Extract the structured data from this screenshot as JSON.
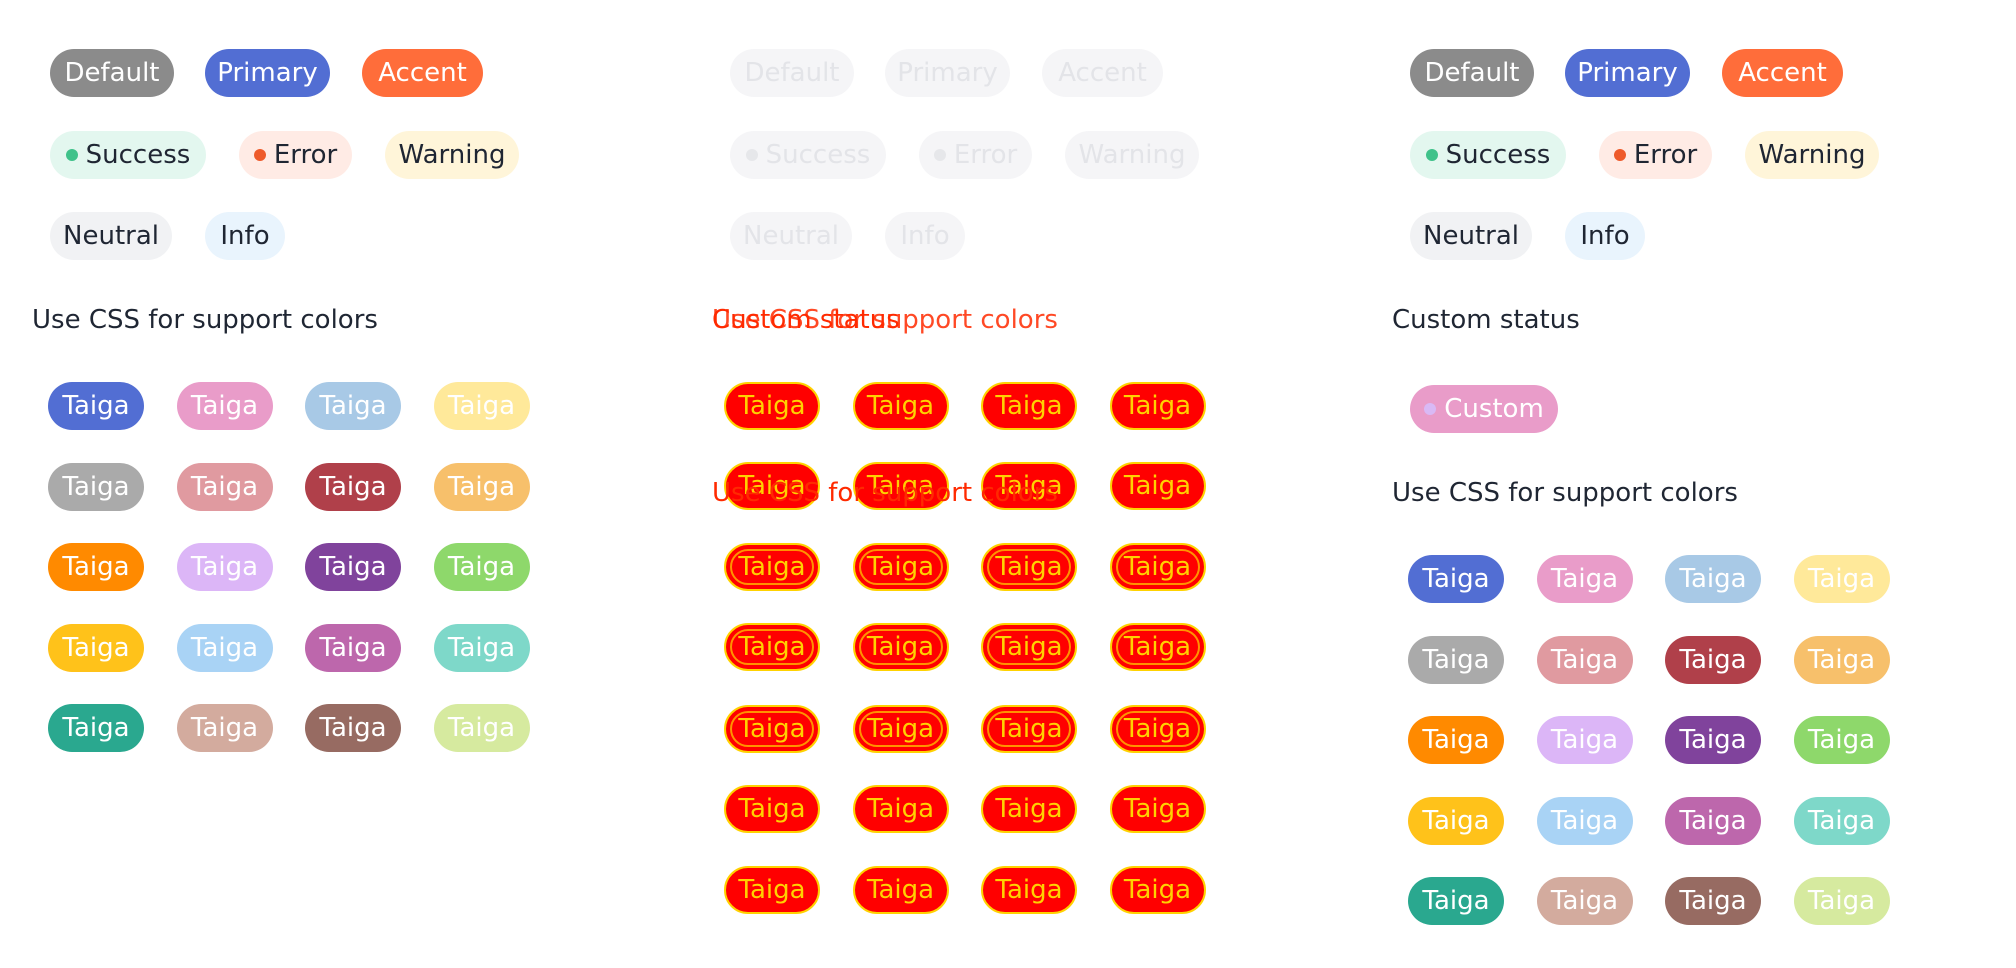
{
  "status_chips": {
    "default": "Default",
    "primary": "Primary",
    "accent": "Accent",
    "success": "Success",
    "error": "Error",
    "warning": "Warning",
    "neutral": "Neutral",
    "info": "Info"
  },
  "headings": {
    "support_colors": "Use CSS for support colors",
    "custom_status": "Custom status",
    "overlay_merged": "Use CSS for support colors"
  },
  "custom_chip": "Custom",
  "support_label": "Taiga",
  "colors": {
    "default": "#8b8b8b",
    "primary": "#526ed3",
    "accent": "#ff6d3a",
    "success_bg": "#e3f7ef",
    "success_dot": "#3fc28a",
    "error_bg": "#ffebe5",
    "error_dot": "#ee5a2a",
    "warning_bg": "#fff5d9",
    "neutral_bg": "#f1f2f4",
    "info_bg": "#e9f4fd",
    "custom_bg": "#e99cc9",
    "custom_dot": "#d9b9f5",
    "support_palette": [
      "#526ed3",
      "#e99cc9",
      "#a8c9e6",
      "#ffe99a",
      "#aaaaaa",
      "#e09aa0",
      "#b0404a",
      "#f7c06b",
      "#ff8a00",
      "#dcb6f7",
      "#80439c",
      "#8ed86b",
      "#ffc21a",
      "#a9d3f5",
      "#bd67ac",
      "#7ed8c9",
      "#2aa88f",
      "#d3ab9e",
      "#976b62",
      "#d6ea9f"
    ],
    "support_text": [
      "#ffffff",
      "#ffffff",
      "#ffffff",
      "#ffffff",
      "#ffffff",
      "#ffffff",
      "#ffffff",
      "#ffffff",
      "#ffffff",
      "#ffffff",
      "#ffffff",
      "#ffffff",
      "#ffffff",
      "#ffffff",
      "#ffffff",
      "#ffffff",
      "#ffffff",
      "#ffffff",
      "#ffffff",
      "#ffffff"
    ]
  }
}
